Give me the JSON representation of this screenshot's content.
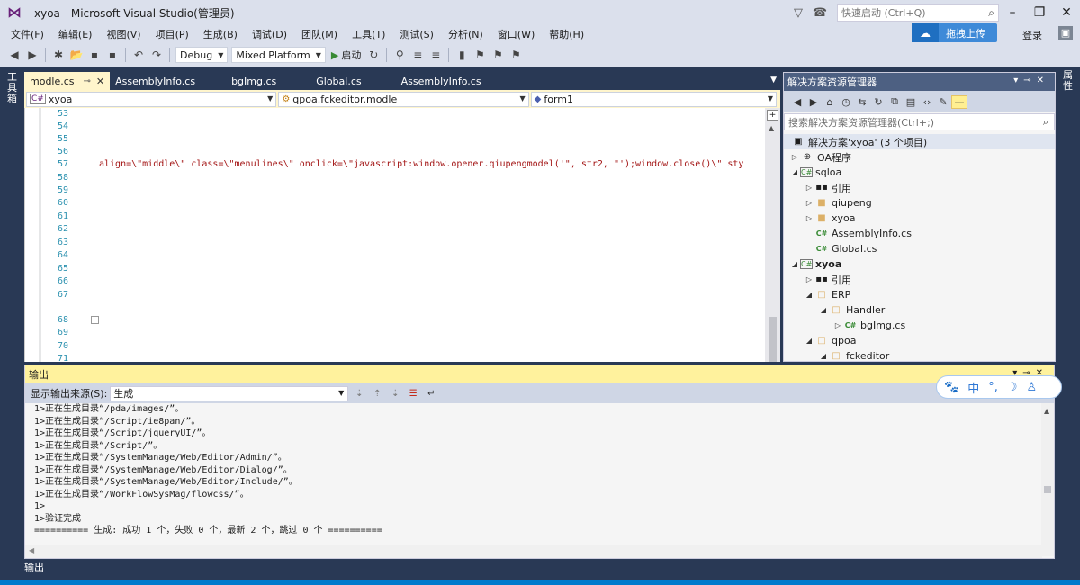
{
  "window": {
    "title": "xyoa - Microsoft Visual Studio(管理员)",
    "quick_launch_placeholder": "快速启动 (Ctrl+Q)",
    "upload_label": "拖拽上传",
    "login_label": "登录"
  },
  "menu": [
    "文件(F)",
    "编辑(E)",
    "视图(V)",
    "项目(P)",
    "生成(B)",
    "调试(D)",
    "团队(M)",
    "工具(T)",
    "测试(S)",
    "分析(N)",
    "窗口(W)",
    "帮助(H)"
  ],
  "toolbar": {
    "config": "Debug",
    "platform": "Mixed Platform",
    "start": "启动"
  },
  "side_labels": {
    "left": "工具箱",
    "right": "属性"
  },
  "tabs": [
    "modle.cs",
    "AssemblyInfo.cs",
    "bgImg.cs",
    "Global.cs",
    "AssemblyInfo.cs"
  ],
  "navbar": {
    "project": "xyoa",
    "class": "qpoa.fckeditor.modle",
    "member": "form1"
  },
  "editor": {
    "line_numbers": [
      "53",
      "54",
      "55",
      "56",
      "57",
      "58",
      "59",
      "60",
      "61",
      "62",
      "63",
      "64",
      "65",
      "66",
      "67",
      "68",
      "69",
      "70",
      "71"
    ],
    "code_line": "align=\\\"middle\\\" class=\\\"menulines\\\" onclick=\\\"javascript:window.opener.qiupengmodel('\", str2, \"');window.close()\\\" sty"
  },
  "solution_explorer": {
    "title": "解决方案资源管理器",
    "search_placeholder": "搜索解决方案资源管理器(Ctrl+;)",
    "tree": [
      {
        "label": "解决方案'xyoa' (3 个项目)",
        "icon": "solution",
        "exp": "",
        "indent": 0
      },
      {
        "label": "OA程序",
        "icon": "globe",
        "exp": "▷",
        "indent": 0
      },
      {
        "label": "sqloa",
        "icon": "proj",
        "exp": "◢",
        "indent": 0
      },
      {
        "label": "引用",
        "icon": "ref",
        "exp": "▷",
        "indent": 1
      },
      {
        "label": "qiupeng",
        "icon": "folder",
        "exp": "▷",
        "indent": 1
      },
      {
        "label": "xyoa",
        "icon": "folder",
        "exp": "▷",
        "indent": 1
      },
      {
        "label": "AssemblyInfo.cs",
        "icon": "cs",
        "exp": "",
        "indent": 1
      },
      {
        "label": "Global.cs",
        "icon": "cs",
        "exp": "",
        "indent": 1
      },
      {
        "label": "xyoa",
        "icon": "proj",
        "exp": "◢",
        "indent": 0,
        "bold": true
      },
      {
        "label": "引用",
        "icon": "ref",
        "exp": "▷",
        "indent": 1
      },
      {
        "label": "ERP",
        "icon": "folder",
        "exp": "◢",
        "indent": 1
      },
      {
        "label": "Handler",
        "icon": "folder",
        "exp": "◢",
        "indent": 2
      },
      {
        "label": "bgImg.cs",
        "icon": "cs",
        "exp": "▷",
        "indent": 3
      },
      {
        "label": "qpoa",
        "icon": "folder",
        "exp": "◢",
        "indent": 1
      },
      {
        "label": "fckeditor",
        "icon": "folder",
        "exp": "◢",
        "indent": 2
      }
    ]
  },
  "output": {
    "title": "输出",
    "source_label": "显示输出来源(S):",
    "source_value": "生成",
    "lines": [
      "1>正在生成目录“/pda/images/”。",
      "1>正在生成目录“/Script/ie8pan/”。",
      "1>正在生成目录“/Script/jqueryUI/”。",
      "1>正在生成目录“/Script/”。",
      "1>正在生成目录“/SystemManage/Web/Editor/Admin/”。",
      "1>正在生成目录“/SystemManage/Web/Editor/Dialog/”。",
      "1>正在生成目录“/SystemManage/Web/Editor/Include/”。",
      "1>正在生成目录“/WorkFlowSysMag/flowcss/”。",
      "1>",
      "1>验证完成",
      "========== 生成: 成功 1 个，失败 0 个，最新 2 个，跳过 0 个 =========="
    ]
  },
  "ime": [
    "中",
    "°,",
    "☽"
  ],
  "bottom_tab": "输出"
}
